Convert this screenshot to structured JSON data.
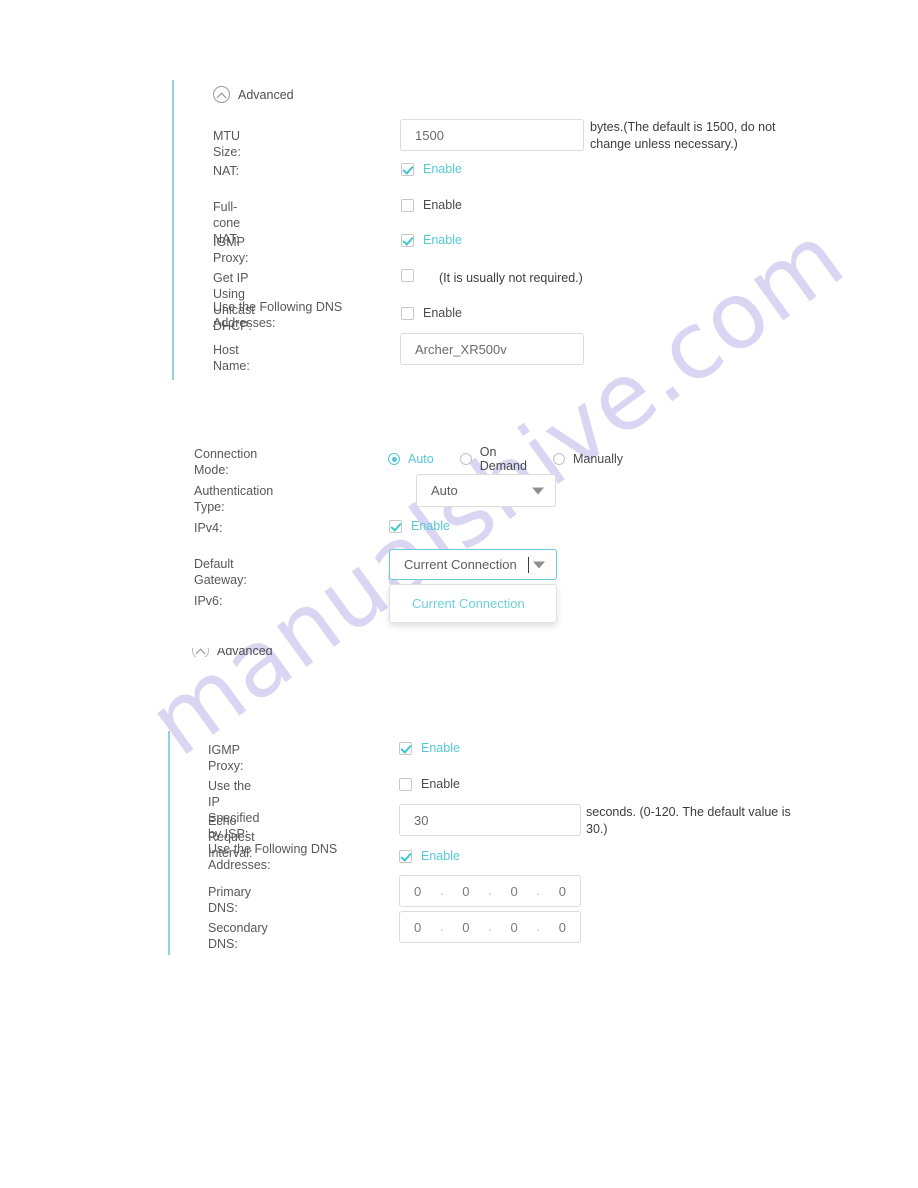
{
  "watermark": {
    "text": "manualshive.com",
    "color": "#d6d4f2"
  },
  "theme": {
    "accent": "#55c9d8",
    "accent_bar": "#8fd3de",
    "label": "#585858"
  },
  "section_advanced_top": {
    "header": {
      "label": "Advanced",
      "icon": "chevron-up-circle-icon"
    },
    "fields": {
      "mtu_size": {
        "label": "MTU Size:",
        "value": "1500",
        "hint": "bytes.(The default is 1500, do not change unless necessary.)"
      },
      "nat": {
        "label": "NAT:",
        "checkbox_label": "Enable",
        "checked": true
      },
      "full_cone_nat": {
        "label": "Full-cone NAT:",
        "checkbox_label": "Enable",
        "checked": false
      },
      "igmp_proxy": {
        "label": "IGMP Proxy:",
        "checkbox_label": "Enable",
        "checked": true
      },
      "unicast_dhcp": {
        "label": "Get IP Using Unicast DHCP:",
        "checked": false,
        "hint": "(It is usually not required.)"
      },
      "use_following_dns": {
        "label": "Use the Following DNS\nAddresses:",
        "checkbox_label": "Enable",
        "checked": false
      },
      "host_name": {
        "label": "Host Name:",
        "value": "Archer_XR500v"
      }
    }
  },
  "section_connection": {
    "fields": {
      "connection_mode": {
        "label": "Connection Mode:",
        "options": [
          "Auto",
          "On Demand",
          "Manually"
        ],
        "selected": "Auto"
      },
      "authentication_type": {
        "label": "Authentication Type:",
        "value": "Auto",
        "icon": "chevron-down-icon"
      },
      "ipv4": {
        "label": "IPv4:",
        "checkbox_label": "Enable",
        "checked": true
      },
      "default_gateway": {
        "label": "Default Gateway:",
        "value": "Current Connection",
        "icon": "chevron-down-icon",
        "open": true,
        "options": [
          "Current Connection"
        ]
      },
      "ipv6": {
        "label": "IPv6:"
      }
    }
  },
  "section_advanced_bottom": {
    "fields": {
      "igmp_proxy": {
        "label": "IGMP Proxy:",
        "checkbox_label": "Enable",
        "checked": true
      },
      "use_ip_specified_by_isp": {
        "label": "Use the IP Specified by ISP:",
        "checkbox_label": "Enable",
        "checked": false
      },
      "echo_request_interval": {
        "label": "Echo Request Interval:",
        "value": "30",
        "hint": "seconds. (0-120. The default value is 30.)"
      },
      "use_following_dns": {
        "label": "Use the Following DNS\nAddresses:",
        "checkbox_label": "Enable",
        "checked": true
      },
      "primary_dns": {
        "label": "Primary DNS:",
        "octets": [
          "0",
          "0",
          "0",
          "0"
        ]
      },
      "secondary_dns": {
        "label": "Secondary DNS:",
        "octets": [
          "0",
          "0",
          "0",
          "0"
        ]
      }
    }
  }
}
